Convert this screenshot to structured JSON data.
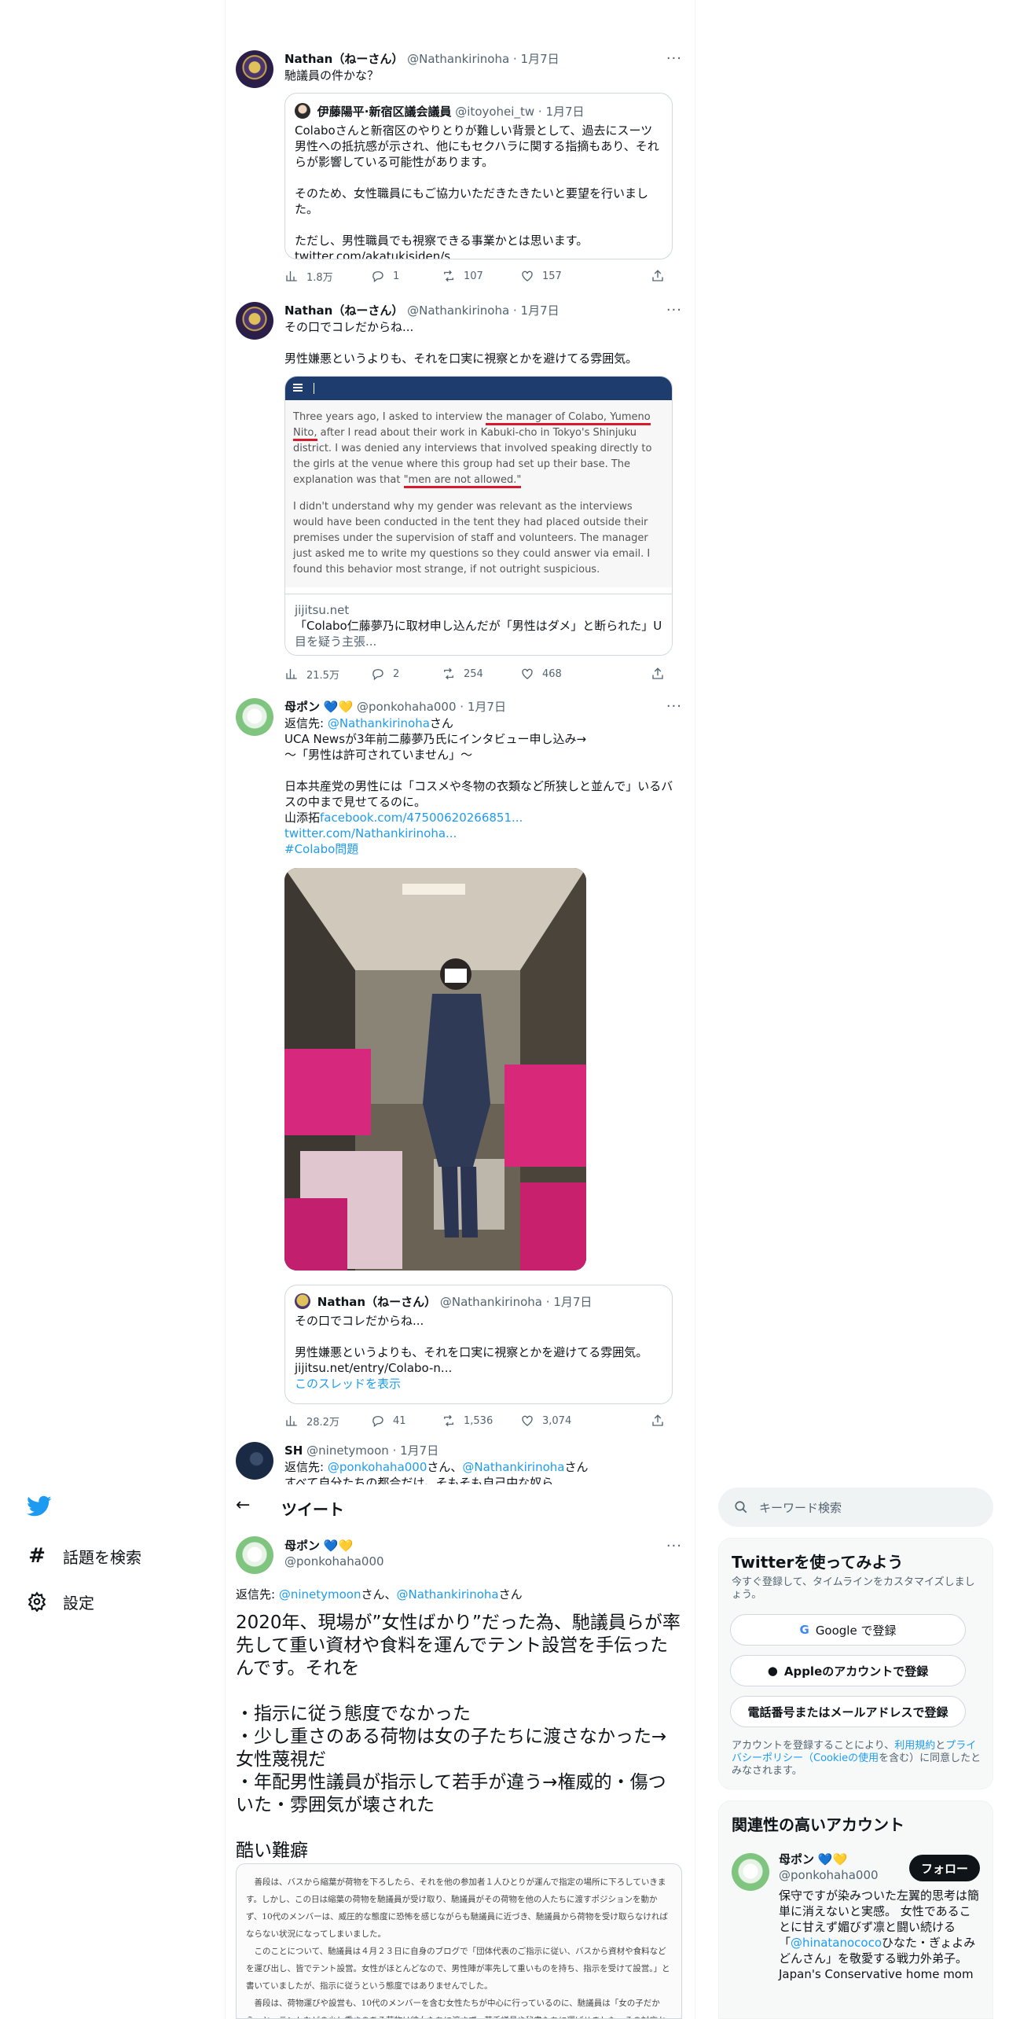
{
  "nav": {
    "explore_label": "話題を検索",
    "settings_label": "設定"
  },
  "tweet1": {
    "name": "Nathan（ねーさん）",
    "handle": "@Nathankirinoha",
    "date": "1月7日",
    "text": "馳議員の件かな？",
    "quote": {
      "name": "伊藤陽平·新宿区議会議員",
      "handle": "@itoyohei_tw",
      "date": "1月7日",
      "text": "Colaboさんと新宿区のやりとりが難しい背景として、過去にスーツ男性への抵抗感が示され、他にもセクハラに関する指摘もあり、それらが影響している可能性があります。\n\nそのため、女性職員にもご協力いただきたきたいと要望を行いました。\n\nただし、男性職員でも視察できる事業かとは思います。\ntwitter.com/akatukisiden/s..."
    },
    "stats": {
      "views": "1.8万",
      "replies": "1",
      "retweets": "107",
      "likes": "157"
    }
  },
  "tweet2": {
    "name": "Nathan（ねーさん）",
    "handle": "@Nathankirinoha",
    "date": "1月7日",
    "text": "その口でコレだからね...\n\n男性嫌悪というよりも、それを口実に視察とかを避けてる雰囲気。",
    "card": {
      "para1_a": "Three years ago, I asked to interview ",
      "para1_hl": "the manager of Colabo, Yumeno Nito,",
      "para1_b": " after I read about their work in Kabuki-cho in Tokyo's Shinjuku district. I was denied any interviews that involved speaking directly to the girls at the venue where this group had set up their base. The explanation was that ",
      "para1_hl2": "\"men are not allowed.\"",
      "para2": "I didn't understand why my gender was relevant as the interviews would have been conducted in the tent they had placed outside their premises under the supervision of staff and volunteers. The manager just asked me to write my questions so they could answer via email. I found this behavior most strange, if not outright suspicious.",
      "domain": "jijitsu.net",
      "title": "「Colabo仁藤夢乃に取材申し込んだが「男性はダメ」と断られた」U...",
      "desc": "目を疑う主張..."
    },
    "stats": {
      "views": "21.5万",
      "replies": "2",
      "retweets": "254",
      "likes": "468"
    }
  },
  "tweet3": {
    "name": "母ポン",
    "handle": "@ponkohaha000",
    "date": "1月7日",
    "reply_prefix": "返信先: ",
    "reply_to": "@Nathankirinoha",
    "reply_suffix": "さん",
    "line1": "UCA Newsが3年前二藤夢乃氏にインタビュー申し込み→",
    "line2": "～「男性は許可されていません」～",
    "line3": "日本共産党の男性には「コスメや冬物の衣類など所狭しと並んで」いるバスの中まで見せてるのに。",
    "line4_prefix": "山添拓",
    "link1": "facebook.com/47500620266851...",
    "link2": "twitter.com/Nathankirinoha...",
    "hashtag": "#Colabo問題",
    "quote": {
      "name": "Nathan（ねーさん）",
      "handle": "@Nathankirinoha",
      "date": "1月7日",
      "text": "その口でコレだからね...\n\n男性嫌悪というよりも、それを口実に視察とかを避けてる雰囲気。\njijitsu.net/entry/Colabo-n...",
      "thread_link": "このスレッドを表示"
    },
    "stats": {
      "views": "28.2万",
      "replies": "41",
      "retweets": "1,536",
      "likes": "3,074"
    }
  },
  "tweet4": {
    "name": "SH",
    "handle": "@ninetymoon",
    "date": "1月7日",
    "reply_prefix": "返信先: ",
    "reply_to1": "@ponkohaha000",
    "reply_mid": "さん、",
    "reply_to2": "@Nathankirinoha",
    "reply_suffix": "さん",
    "text": "すべて自分たちの都合だけ。そもそも自己中な奴ら"
  },
  "detail": {
    "header": "ツイート",
    "name": "母ポン",
    "handle": "@ponkohaha000",
    "reply_prefix": "返信先: ",
    "reply_to1": "@ninetymoon",
    "reply_mid": "さん、",
    "reply_to2": "@Nathankirinoha",
    "reply_suffix": "さん",
    "main_text": "2020年、現場が”女性ばかり”だった為、馳議員らが率先して重い資材や食料を運んでテント設営を手伝ったんです。それを\n\n・指示に従う態度でなかった\n・少し重さのある荷物は女の子たちに渡さなかった→女性蔑視だ\n・年配男性議員が指示して若手が違う→権威的・傷ついた・雰囲気が壊された\n\n酷い難癖",
    "scan_text": "　善段は、バスから縮葉が荷物を下ろしたら、それを他の参加者１人ひとりが運んで指定の場所に下ろしていきます。しかし、この日は縮葉の荷物を馳議員が受け取り、馳議員がその荷物を他の人たちに渡すポジションを動かず、10代のメンバーは、威圧的な態度に恐怖を感じながらも馳議員に近づき、馳議員から荷物を受け取らなければならない状況になってしまいました。\n　このことについて、馳議員は４月２３日に自身のブログで「団体代表のご指示に従い、バスから資材や食料などを運び出し、皆でテント設営。女性がほとんどなので、男性陣が率先して重いものを持ち、指示を受けて設営。」と書いていましたが、指示に従うという態度ではありませんでした。\n　善段は、荷物運びや設営も、10代のメンバーを含む女性たちが中心に行っているのに、馳議員は「女の子だから」と、テントなどの少し重さのある荷物は彼女たちに渡さず、若手議員や秘書たちに運ばせました。その対応から、女性蔑視の考えも伝わってきました。"
  },
  "sidebar": {
    "search_placeholder": "キーワード検索",
    "signup": {
      "title": "Twitterを使ってみよう",
      "subtitle": "今すぐ登録して、タイムラインをカスタマイズしましょう。",
      "google": "Google で登録",
      "apple": "Appleのアカウントで登録",
      "phone": "電話番号またはメールアドレスで登録",
      "legal_prefix": "アカウントを登録することにより、",
      "terms": "利用規約",
      "and": "と",
      "privacy": "プライバシーポリシー（Cookieの使用",
      "legal_suffix": "を含む）に同意したとみなされます。"
    },
    "related": {
      "title": "関連性の高いアカウント",
      "name": "母ポン",
      "handle": "@ponkohaha000",
      "follow": "フォロー",
      "bio_a": "保守ですが染みついた左翼的思考は簡単に消えないと実感。 女性であることに甘えず媚びず凛と闘い続ける「",
      "bio_link": "@hinatanococo",
      "bio_b": "ひなた・ぎょよみどんさん」を敬愛する戦力外弟子。 Japan's Conservative home mom"
    }
  },
  "colors": {
    "accent": "#1d9bf0",
    "text": "#0f1419",
    "muted": "#536471",
    "border": "#cfd9de"
  }
}
